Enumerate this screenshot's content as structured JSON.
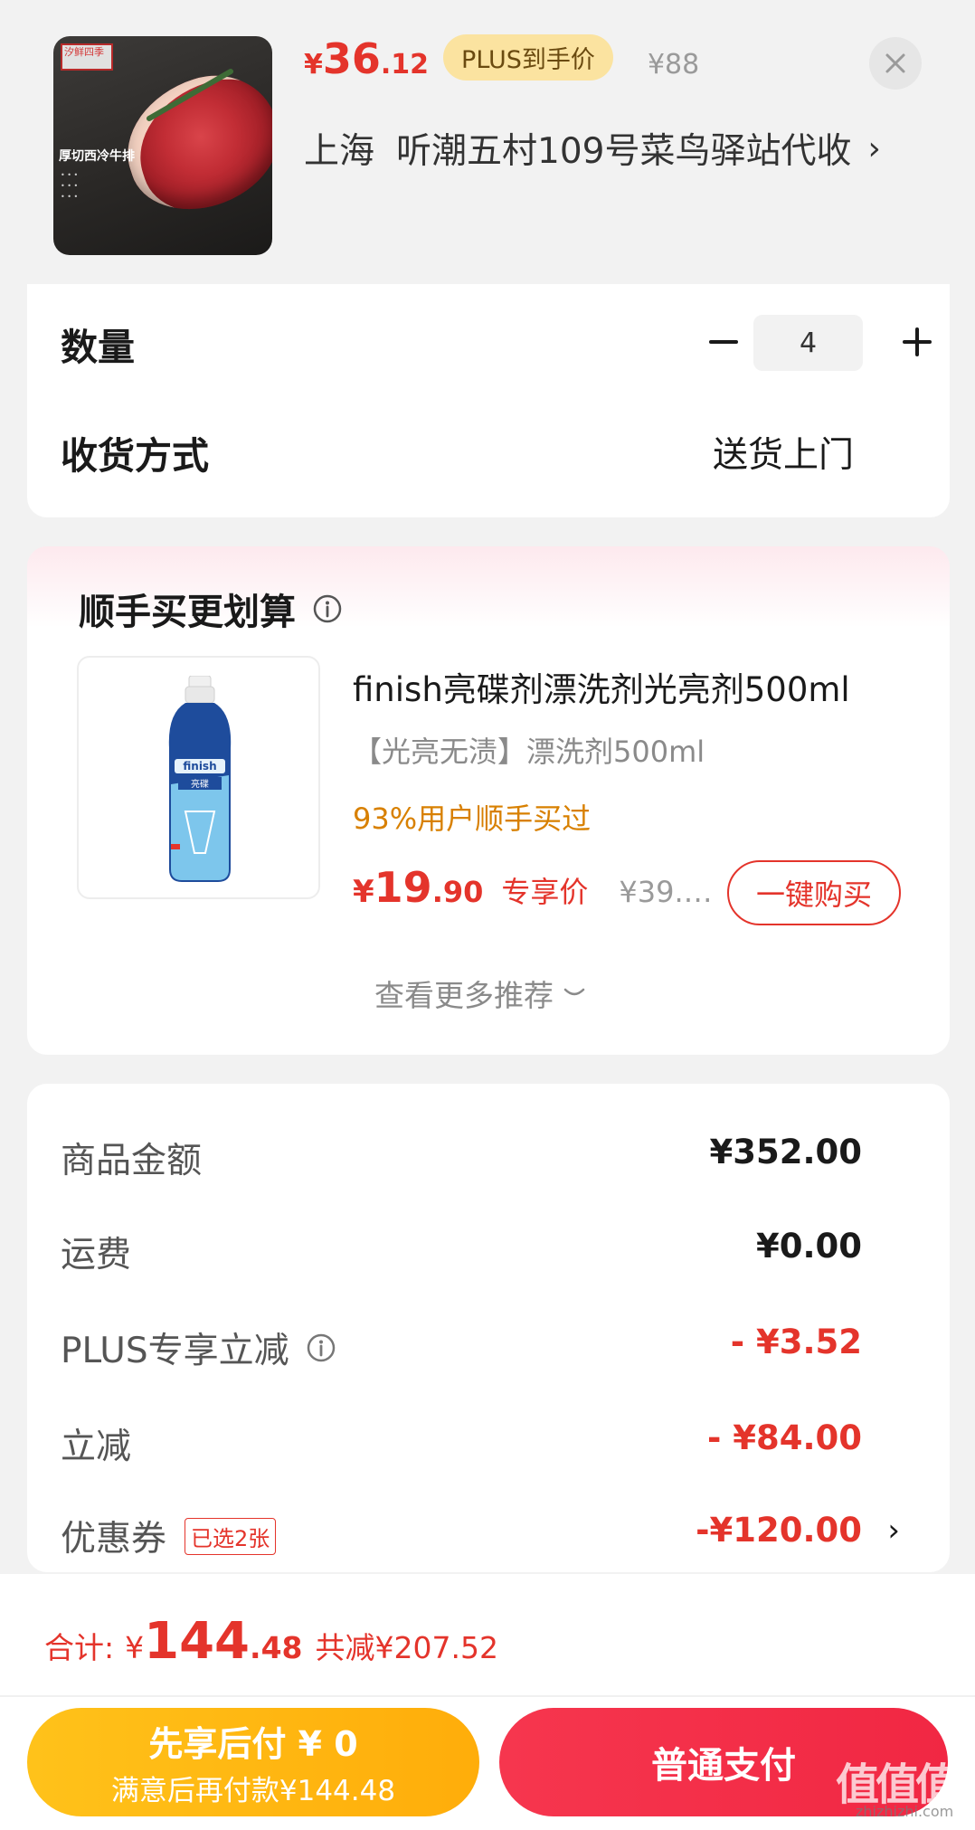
{
  "header": {
    "product_image_alt": "厚切西冷牛排",
    "product_image_brand": "汐鲜四季",
    "product_image_title": "厚切西冷牛排",
    "price_yen": "¥",
    "price_int": "36",
    "price_dec": ".12",
    "plus_badge": "PLUS到手价",
    "original_price": "¥88",
    "address_city": "上海",
    "address_detail": "听潮五村109号菜鸟驿站代收",
    "address_chevron": "›"
  },
  "order_options": {
    "quantity_label": "数量",
    "quantity_value": "4",
    "delivery_label": "收货方式",
    "delivery_value": "送货上门"
  },
  "recommendation": {
    "title": "顺手买更划算",
    "product_name": "finish亮碟剂漂洗剂光亮剂500ml",
    "product_subtitle": "【光亮无渍】漂洗剂500ml",
    "buyers_text": "93%用户顺手买过",
    "price_yen": "¥",
    "price_int": "19",
    "price_dec": ".90",
    "price_tag": "专享价",
    "original_price": "¥39.…",
    "buy_button": "一键购买",
    "more_link": "查看更多推荐"
  },
  "summary": {
    "rows": [
      {
        "label": "商品金额",
        "value": "¥352.00"
      },
      {
        "label": "运费",
        "value": "¥0.00"
      },
      {
        "label": "PLUS专享立减",
        "value": "- ¥3.52"
      },
      {
        "label": "立减",
        "value": "- ¥84.00"
      },
      {
        "label": "优惠券",
        "value": "-¥120.00",
        "chip": "已选2张"
      }
    ]
  },
  "footer": {
    "total_label": "合计:",
    "total_yen": "¥",
    "total_int": "144",
    "total_dec": ".48",
    "saved_text": "共减¥207.52",
    "pay_later_line1": "先享后付 ¥ 0",
    "pay_later_line2": "满意后再付款¥144.48",
    "pay_now": "普通支付"
  },
  "watermark": {
    "text": "值值值",
    "sub": "zhizhizhi.com"
  },
  "colors": {
    "accent_red": "#e4342b",
    "plus_gold": "#fbe3a0",
    "pay_later_yellow": "#ffc21a",
    "pay_now_red": "#f6364e",
    "buyers_orange": "#d88000"
  }
}
